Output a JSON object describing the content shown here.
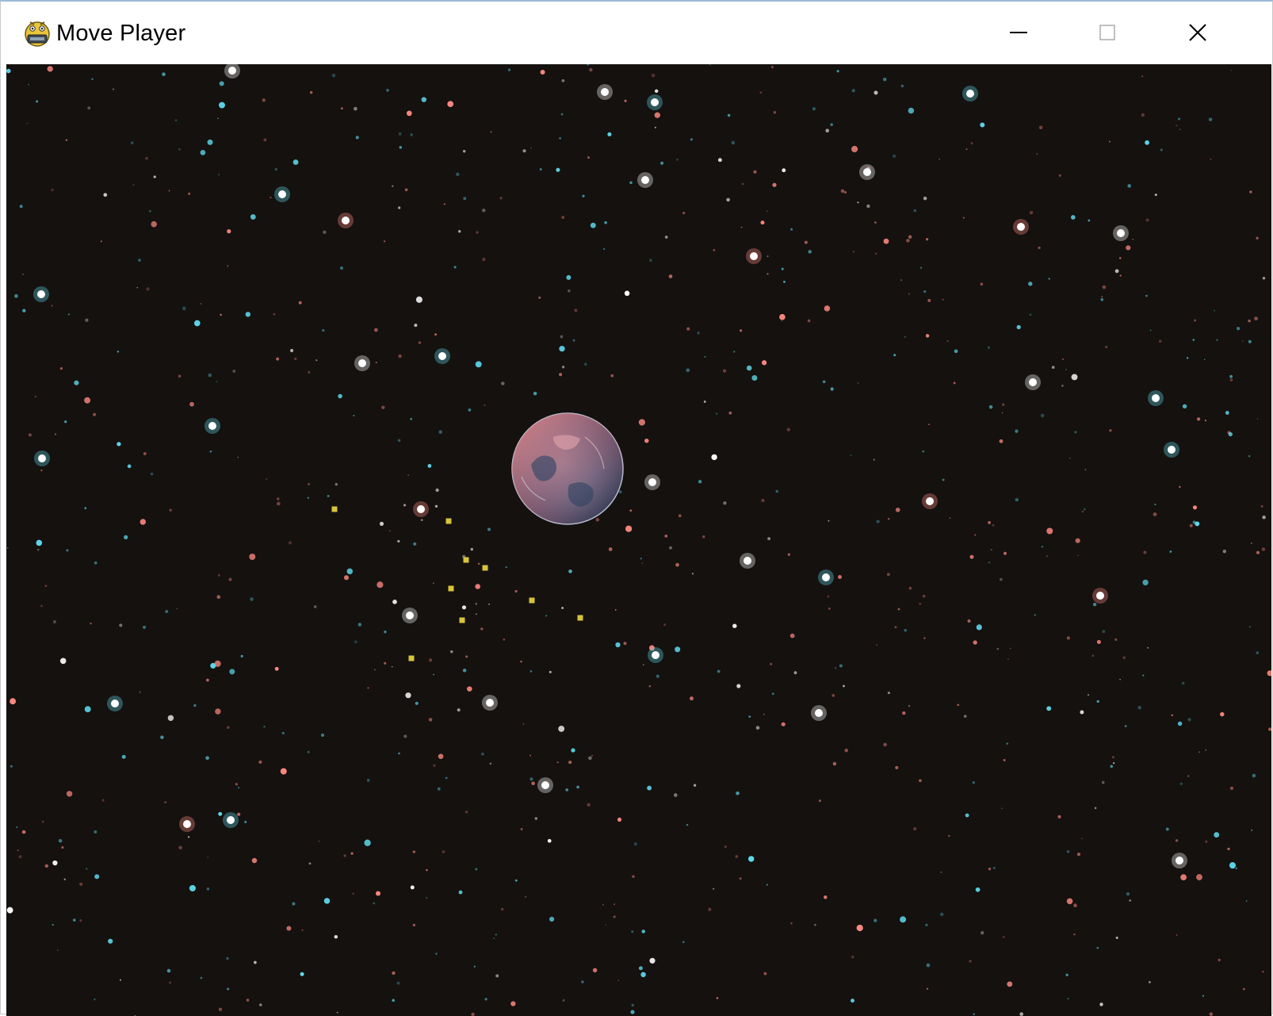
{
  "window": {
    "title": "Move Player",
    "app_icon": "pygame-snake-icon",
    "controls": {
      "minimize_icon": "minimize-icon",
      "maximize_icon": "maximize-icon",
      "close_icon": "close-icon"
    }
  },
  "game": {
    "background": "starfield",
    "player": "planet-sprite",
    "particles": "yellow-sparkle-particles",
    "colors": {
      "space": "#14110f",
      "star_cyan": "#5fd8ec",
      "star_red": "#ff8a80",
      "star_white": "#ffffff",
      "particle": "#d8c43a",
      "planet_blue": "#4a6f9c",
      "planet_red": "#d87a80"
    }
  }
}
